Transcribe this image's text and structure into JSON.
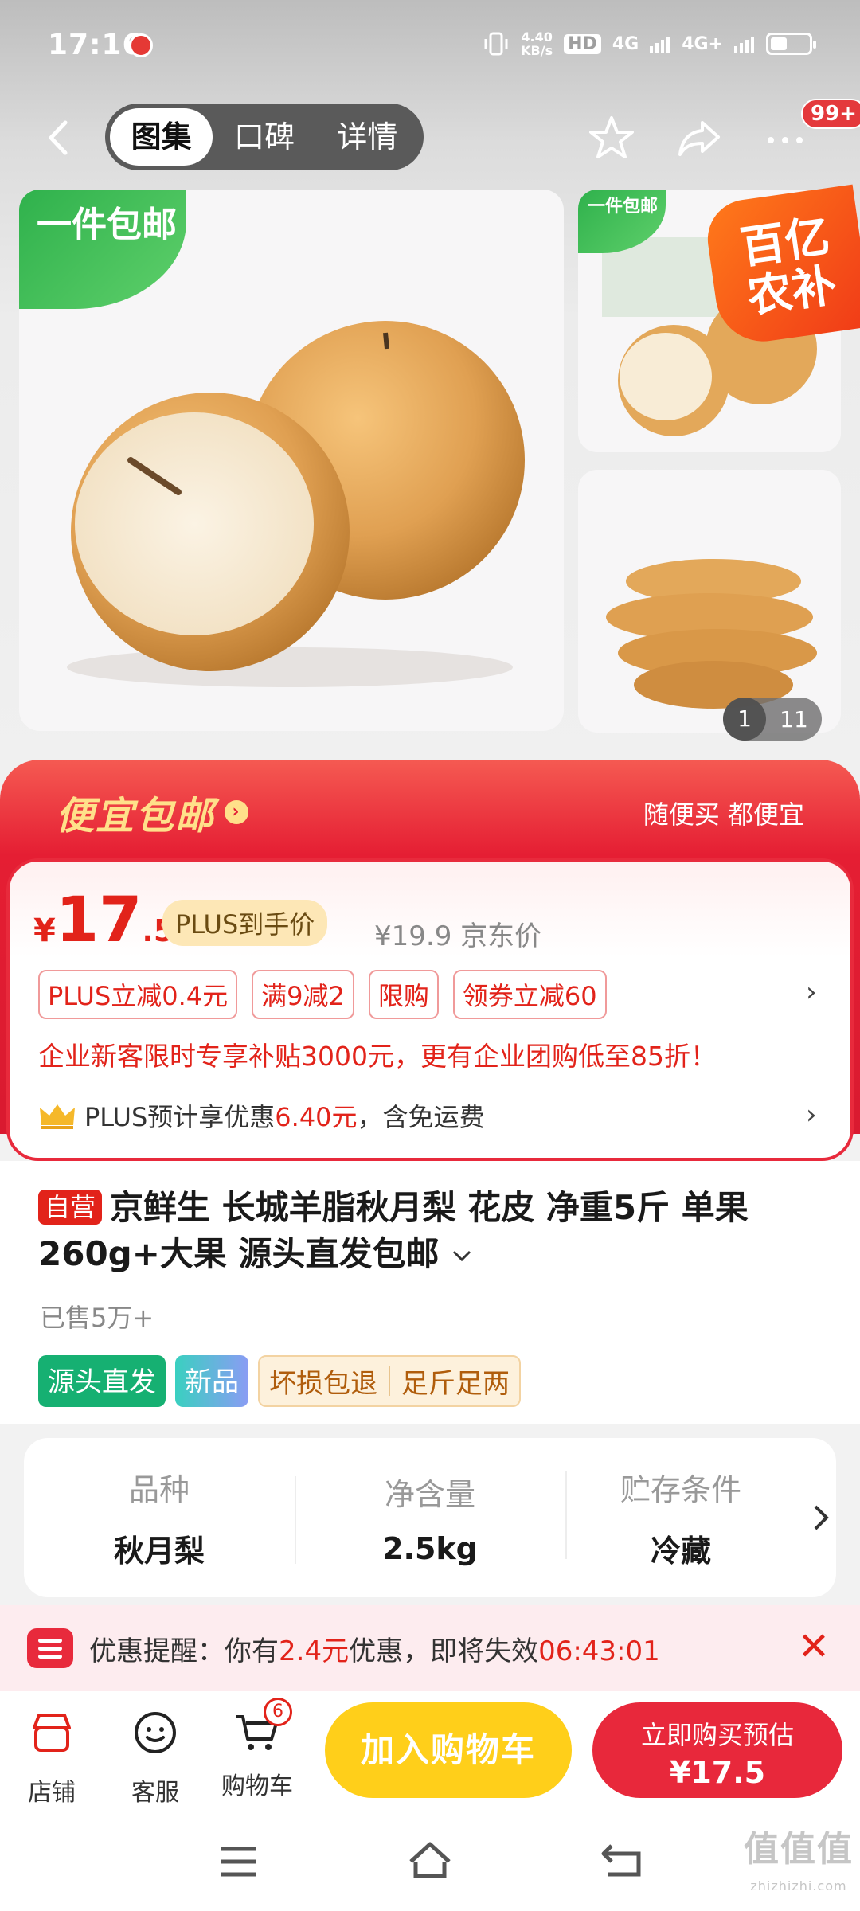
{
  "status_bar": {
    "time": "17:16",
    "net_speed_value": "4.40",
    "net_speed_unit": "KB/s",
    "hd_label": "HD",
    "network1": "4G",
    "network2": "4G+"
  },
  "nav": {
    "tabs": [
      {
        "label": "图集",
        "active": true
      },
      {
        "label": "口碑",
        "active": false
      },
      {
        "label": "详情",
        "active": false
      }
    ],
    "message_badge": "99+"
  },
  "gallery": {
    "main_tag": "一件包邮",
    "thumb_tag": "一件包邮",
    "subsidy_badge": "百亿农补",
    "counter_current": "1",
    "counter_total": "11"
  },
  "promo": {
    "title": "便宜包邮",
    "subtitle": "随便买 都便宜"
  },
  "price": {
    "currency": "¥",
    "integer": "17",
    "decimal": ".5",
    "plus_label": "PLUS到手价",
    "original": "¥19.9 京东价",
    "coupons": [
      "PLUS立减0.4元",
      "满9减2",
      "限购",
      "领券立减60"
    ],
    "enterprise_note": "企业新客限时专享补贴3000元，更有企业团购低至85折！",
    "plus_note_prefix": "PLUS预计享优惠",
    "plus_note_amount": "6.40元",
    "plus_note_suffix": "，含免运费"
  },
  "product": {
    "self_operated": "自营",
    "title": "京鲜生 长城羊脂秋月梨 花皮 净重5斤 单果260g+大果 源头直发包邮",
    "sold": "已售5万+",
    "tags": [
      "源头直发",
      "新品"
    ],
    "service_tags": [
      "坏损包退",
      "足斤足两"
    ]
  },
  "specs": [
    {
      "key": "品种",
      "value": "秋月梨"
    },
    {
      "key": "净含量",
      "value": "2.5kg"
    },
    {
      "key": "贮存条件",
      "value": "冷藏"
    }
  ],
  "reminder": {
    "label": "优惠提醒：你有",
    "amount": "2.4元",
    "middle": "优惠，即将失效",
    "countdown": "06:43:01"
  },
  "bottom_bar": {
    "store": "店铺",
    "service": "客服",
    "cart": "购物车",
    "cart_count": "6",
    "add_to_cart": "加入购物车",
    "buy_line1": "立即购买预估",
    "buy_line2": "¥17.5"
  },
  "watermark": {
    "text": "值值值",
    "site": "zhizhizhi.com"
  },
  "colors": {
    "accent_red": "#e2231a",
    "cart_yellow": "#ffcf1a",
    "source_green": "#16b072"
  }
}
